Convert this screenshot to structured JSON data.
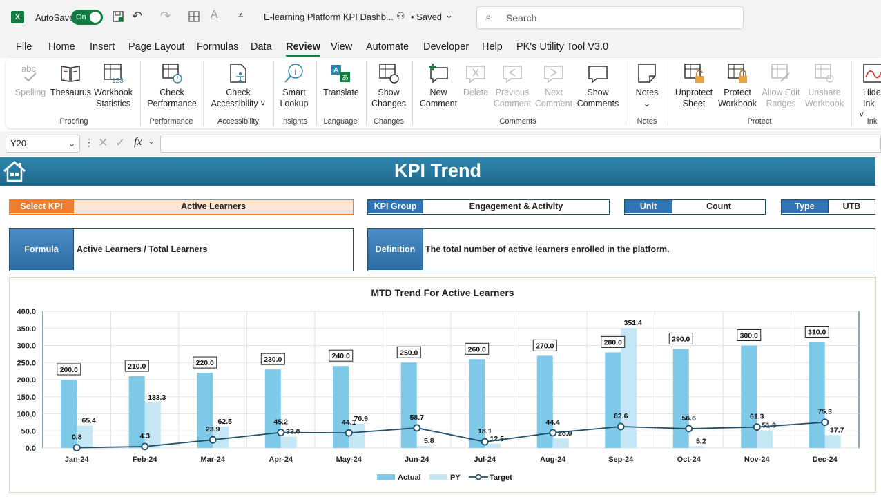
{
  "titlebar": {
    "autosave_label": "AutoSave",
    "autosave_state": "On",
    "doc_title": "E-learning Platform KPI Dashb...",
    "saved_status": "• Saved",
    "search_placeholder": "Search"
  },
  "menu": [
    "File",
    "Home",
    "Insert",
    "Page Layout",
    "Formulas",
    "Data",
    "Review",
    "View",
    "Automate",
    "Developer",
    "Help",
    "PK's Utility Tool V3.0"
  ],
  "active_menu": "Review",
  "ribbon": {
    "spelling": "Spelling",
    "thesaurus": "Thesaurus",
    "workbook_stats_1": "Workbook",
    "workbook_stats_2": "Statistics",
    "check_perf_1": "Check",
    "check_perf_2": "Performance",
    "check_access_1": "Check",
    "check_access_2": "Accessibility ˅",
    "smart_1": "Smart",
    "smart_2": "Lookup",
    "translate": "Translate",
    "show_changes_1": "Show",
    "show_changes_2": "Changes",
    "new_comment_1": "New",
    "new_comment_2": "Comment",
    "delete": "Delete",
    "previous_1": "Previous",
    "previous_2": "Comment",
    "next_1": "Next",
    "next_2": "Comment",
    "show_comments_1": "Show",
    "show_comments_2": "Comments",
    "notes": "Notes",
    "unprotect_1": "Unprotect",
    "unprotect_2": "Sheet",
    "protect_1": "Protect",
    "protect_2": "Workbook",
    "allow_edit_1": "Allow Edit",
    "allow_edit_2": "Ranges",
    "unshare_1": "Unshare",
    "unshare_2": "Workbook",
    "hide_ink_1": "Hide",
    "hide_ink_2": "Ink ˅",
    "groups": {
      "proofing": "Proofing",
      "performance": "Performance",
      "accessibility": "Accessibility",
      "insights": "Insights",
      "language": "Language",
      "changes": "Changes",
      "comments": "Comments",
      "notes": "Notes",
      "protect": "Protect",
      "ink": "Ink"
    }
  },
  "formula_bar": {
    "cell_ref": "Y20",
    "fx": "fx",
    "value": ""
  },
  "dashboard": {
    "title": "KPI Trend",
    "select_kpi_label": "Select KPI",
    "select_kpi_value": "Active Learners",
    "kpi_group_label": "KPI Group",
    "kpi_group_value": "Engagement & Activity",
    "unit_label": "Unit",
    "unit_value": "Count",
    "type_label": "Type",
    "type_value": "UTB",
    "formula_label": "Formula",
    "formula_value": "Active Learners / Total Learners",
    "definition_label": "Definition",
    "definition_value": "The total number of active learners enrolled in the platform."
  },
  "colors": {
    "excel_green": "#107c41",
    "banner": "#2e86ab",
    "actual": "#7ec8e8",
    "py": "#c5e6f4",
    "target": "#1f4e6b",
    "select_orange": "#ed7d31"
  },
  "chart_data": {
    "type": "bar",
    "title": "MTD Trend For Active Learners",
    "categories": [
      "Jan-24",
      "Feb-24",
      "Mar-24",
      "Apr-24",
      "May-24",
      "Jun-24",
      "Jul-24",
      "Aug-24",
      "Sep-24",
      "Oct-24",
      "Nov-24",
      "Dec-24"
    ],
    "series": [
      {
        "name": "Actual",
        "kind": "bar",
        "values": [
          200.0,
          210.0,
          220.0,
          230.0,
          240.0,
          250.0,
          260.0,
          270.0,
          280.0,
          290.0,
          300.0,
          310.0
        ]
      },
      {
        "name": "PY",
        "kind": "bar",
        "values": [
          65.4,
          133.3,
          62.5,
          33.0,
          70.9,
          5.8,
          12.5,
          28.0,
          351.4,
          5.2,
          51.8,
          37.7
        ]
      },
      {
        "name": "Target",
        "kind": "line",
        "values": [
          0.8,
          4.3,
          23.9,
          45.2,
          44.1,
          58.7,
          18.1,
          44.4,
          62.6,
          56.6,
          61.3,
          75.3
        ]
      }
    ],
    "ylim": [
      0,
      400
    ],
    "yticks": [
      "0.0",
      "50.0",
      "100.0",
      "150.0",
      "200.0",
      "250.0",
      "300.0",
      "350.0",
      "400.0"
    ],
    "legend": "bottom",
    "grid": true
  }
}
